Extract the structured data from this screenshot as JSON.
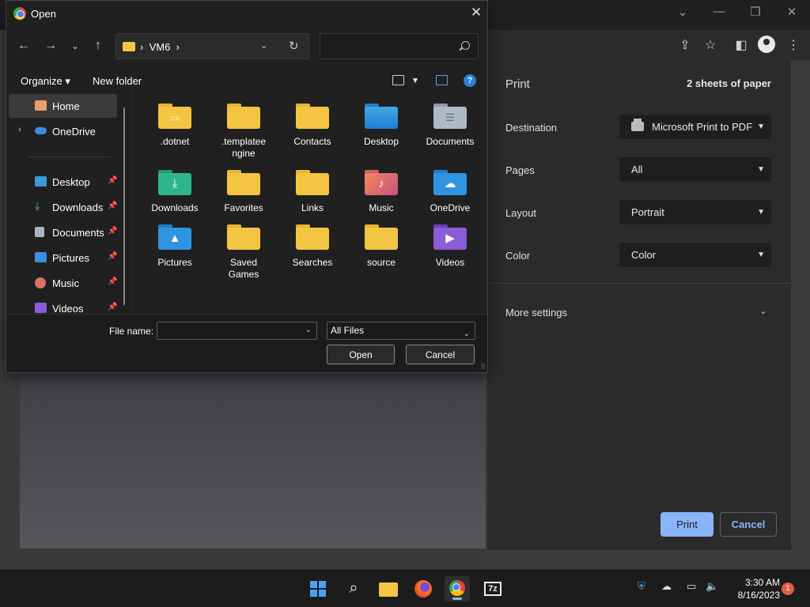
{
  "dialog": {
    "title": "Open",
    "close_glyph": "✕",
    "address": {
      "path": "VM6"
    },
    "search": {
      "placeholder": "",
      "value": ""
    },
    "commands": {
      "organize": "Organize",
      "new_folder": "New folder"
    },
    "help_glyph": "?",
    "sidebar": [
      {
        "label": "Home",
        "icon": "home-icon",
        "pinned": false
      },
      {
        "label": "OneDrive",
        "icon": "cloud-icon",
        "pinned": false
      },
      {
        "label": "Desktop",
        "icon": "desktop-icon",
        "pinned": true
      },
      {
        "label": "Downloads",
        "icon": "download-icon",
        "pinned": true
      },
      {
        "label": "Documents",
        "icon": "document-icon",
        "pinned": true
      },
      {
        "label": "Pictures",
        "icon": "picture-icon",
        "pinned": true
      },
      {
        "label": "Music",
        "icon": "music-icon",
        "pinned": true
      },
      {
        "label": "Videos",
        "icon": "video-icon",
        "pinned": true
      }
    ],
    "files": [
      {
        "label": ".dotnet",
        "icon": "folder-icon"
      },
      {
        "label": ".templateengine",
        "icon": "folder-icon"
      },
      {
        "label": "Contacts",
        "icon": "folder-icon"
      },
      {
        "label": "Desktop",
        "icon": "desktop-folder-icon"
      },
      {
        "label": "Documents",
        "icon": "documents-folder-icon"
      },
      {
        "label": "Downloads",
        "icon": "downloads-folder-icon"
      },
      {
        "label": "Favorites",
        "icon": "folder-icon"
      },
      {
        "label": "Links",
        "icon": "folder-icon"
      },
      {
        "label": "Music",
        "icon": "music-folder-icon"
      },
      {
        "label": "OneDrive",
        "icon": "onedrive-folder-icon"
      },
      {
        "label": "Pictures",
        "icon": "pictures-folder-icon"
      },
      {
        "label": "Saved Games",
        "icon": "folder-icon"
      },
      {
        "label": "Searches",
        "icon": "folder-icon"
      },
      {
        "label": "source",
        "icon": "folder-icon"
      },
      {
        "label": "Videos",
        "icon": "videos-folder-icon"
      }
    ],
    "file_name": {
      "label": "File name:",
      "value": ""
    },
    "file_type": "All Files",
    "open_button": "Open",
    "cancel_button": "Cancel"
  },
  "print": {
    "title": "Print",
    "sheets": "2 sheets of paper",
    "destination": {
      "label": "Destination",
      "value": "Microsoft Print to PDF"
    },
    "pages": {
      "label": "Pages",
      "value": "All"
    },
    "layout": {
      "label": "Layout",
      "value": "Portrait"
    },
    "color": {
      "label": "Color",
      "value": "Color"
    },
    "more_settings": "More settings",
    "print_button": "Print",
    "cancel_button": "Cancel"
  },
  "taskbar": {
    "time": "3:30 AM",
    "date": "8/16/2023",
    "notifications": "1"
  },
  "colors": {
    "accent": "#8ab4f8",
    "folder": "#f4c542",
    "dialog_bg": "#202020"
  }
}
